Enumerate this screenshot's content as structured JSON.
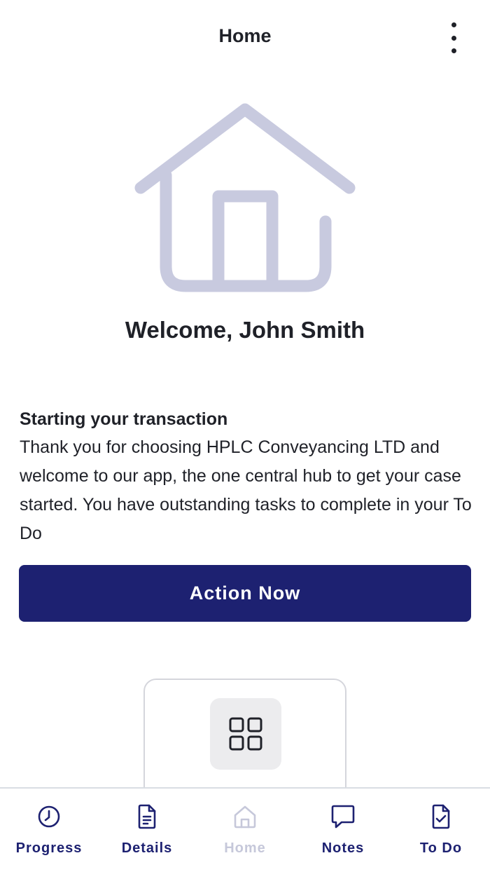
{
  "header": {
    "title": "Home",
    "menu_icon": "more-vertical-icon"
  },
  "hero": {
    "icon": "house-icon",
    "icon_color": "#c8cadf",
    "welcome": "Welcome, John Smith"
  },
  "content": {
    "title": "Starting your transaction",
    "body": "Thank you for choosing HPLC Conveyancing LTD and welcome to our app, the one central hub to get your case started. You have outstanding tasks to complete in your To Do"
  },
  "action": {
    "label": "Action Now",
    "color": "#1d2171"
  },
  "card": {
    "icon": "grid-icon"
  },
  "nav": {
    "active_color": "#c6c8da",
    "color": "#1d2171",
    "items": [
      {
        "label": "Progress",
        "icon": "clock-icon"
      },
      {
        "label": "Details",
        "icon": "document-icon"
      },
      {
        "label": "Home",
        "icon": "home-icon"
      },
      {
        "label": "Notes",
        "icon": "chat-bubble-icon"
      },
      {
        "label": "To Do",
        "icon": "checklist-document-icon"
      }
    ]
  }
}
